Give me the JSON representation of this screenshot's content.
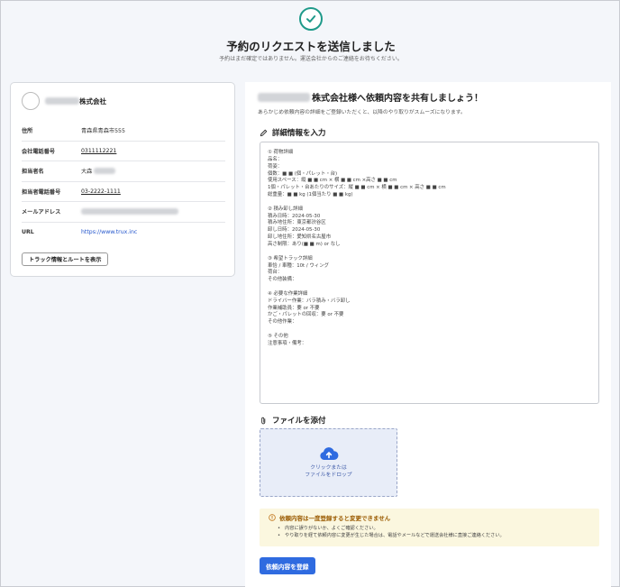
{
  "header": {
    "title": "予約のリクエストを送信しました",
    "subtitle": "予約はまだ確定ではありません。運送会社からのご連絡をお待ちください。"
  },
  "company_card": {
    "company_suffix": "株式会社",
    "rows": [
      {
        "label": "住所",
        "value": "青森県青森市555"
      },
      {
        "label": "会社電話番号",
        "value": "0311112221"
      },
      {
        "label": "担当者名",
        "value": "大森"
      },
      {
        "label": "担当者電話番号",
        "value": "03-2222-1111"
      },
      {
        "label": "メールアドレス",
        "value": ""
      },
      {
        "label": "URL",
        "value": "https://www.trux.inc"
      }
    ],
    "track_button": "トラック情報とルートを表示"
  },
  "panel": {
    "heading_suffix": "株式会社様へ依頼内容を共有しましょう！",
    "description": "あらかじめ依頼内容の詳細をご登録いただくと、以降のやり取りがスムーズになります。",
    "details_heading": "詳細情報を入力",
    "details_text": "① 荷物詳細\n品名：\n荷姿：\n個数：■ ■ (個・パレット・台)\n使用スペース：縦 ■ ■ cm × 横 ■ ■ cm ×高さ ■ ■ cm\n1個・パレット・台あたりのサイズ：縦 ■ ■ cm × 横 ■ ■ cm × 高さ ■ ■ cm\n総重量：■ ■ kg (1個当たり ■ ■ kg)\n\n② 積み卸し詳細\n積み日時：2024-05-30\n積み地住所：東京都渋谷区\n卸し日時：2024-05-30\n卸し地住所：愛知県名古屋市\n高さ制限：あり(■ ■ m) or なし\n\n③ 希望トラック詳細\n車恰 / 車種：10t / ウィング\n荷台：\nその他装備：\n\n④ 必要な作業詳細\nドライバー作業：バラ積み・バラ卸し\n作業補助員：要 or 不要\nかご・パレットの回収：要 or 不要\nその他作業：\n\n⑤ その他\n注意事項・備考：",
    "file_heading": "ファイルを添付",
    "drop_line1": "クリックまたは",
    "drop_line2": "ファイルをドロップ",
    "warning_title": "依頼内容は一度登録すると変更できません",
    "warning_items": [
      "内容に誤りがないか、よくご確認ください。",
      "やり取りを経て依頼内容に変更が生じた場合は、電話やメールなどで運送会社様に直接ご連絡ください。"
    ],
    "submit_button": "依頼内容を登録"
  },
  "colors": {
    "accent": "#2f6be0",
    "success": "#1f9a8a",
    "warning_bg": "#fbf7df",
    "warning_text": "#9a5a00"
  }
}
